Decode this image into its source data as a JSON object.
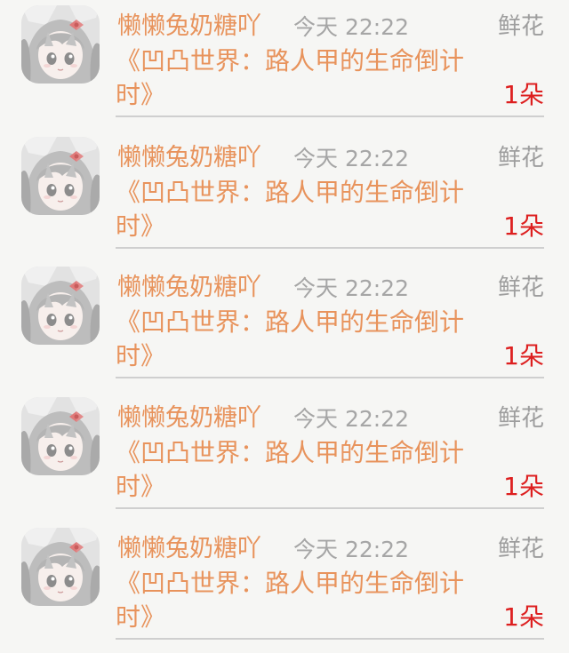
{
  "records": [
    {
      "user": "懒懒兔奶糖吖",
      "time": "今天 22:22",
      "gift_type": "鲜花",
      "book": "《凹凸世界：路人甲的生命倒计时》",
      "count": "1朵",
      "avatar_icon": "anime-girl-avatar-icon"
    },
    {
      "user": "懒懒兔奶糖吖",
      "time": "今天 22:22",
      "gift_type": "鲜花",
      "book": "《凹凸世界：路人甲的生命倒计时》",
      "count": "1朵",
      "avatar_icon": "anime-girl-avatar-icon"
    },
    {
      "user": "懒懒兔奶糖吖",
      "time": "今天 22:22",
      "gift_type": "鲜花",
      "book": "《凹凸世界：路人甲的生命倒计时》",
      "count": "1朵",
      "avatar_icon": "anime-girl-avatar-icon"
    },
    {
      "user": "懒懒兔奶糖吖",
      "time": "今天 22:22",
      "gift_type": "鲜花",
      "book": "《凹凸世界：路人甲的生命倒计时》",
      "count": "1朵",
      "avatar_icon": "anime-girl-avatar-icon"
    },
    {
      "user": "懒懒兔奶糖吖",
      "time": "今天 22:22",
      "gift_type": "鲜花",
      "book": "《凹凸世界：路人甲的生命倒计时》",
      "count": "1朵",
      "avatar_icon": "anime-girl-avatar-icon"
    }
  ],
  "colors": {
    "username": "#e8935c",
    "book_title": "#e8935c",
    "timestamp": "#a6a6a6",
    "gift_type": "#9e9e9e",
    "count": "#dd1f1f",
    "background": "#f6f6f4"
  }
}
